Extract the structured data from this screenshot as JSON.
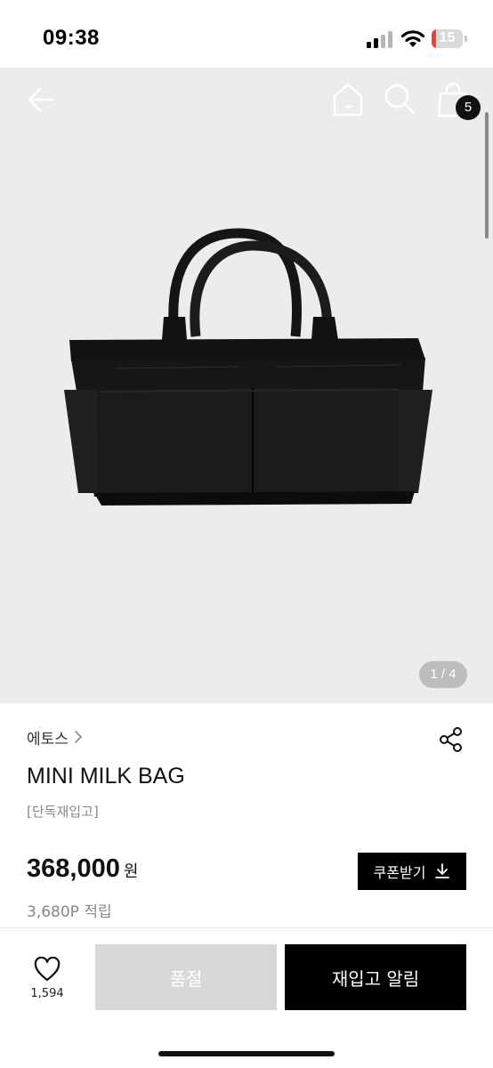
{
  "status_bar": {
    "time": "09:38",
    "battery_level": "15",
    "battery_fraction": 0.15,
    "icons": [
      "signal-icon",
      "wifi-icon",
      "battery-icon"
    ]
  },
  "nav": {
    "icons": [
      "back-arrow-icon",
      "home-icon",
      "search-icon",
      "shopping-bag-icon"
    ],
    "cart_count": "5"
  },
  "gallery": {
    "page_indicator": "1 / 4",
    "image": "black leather tote bag with two front pockets and rolled handles"
  },
  "product": {
    "brand": "에토스",
    "brand_chevron": "chevron-right-icon",
    "name": "MINI MILK BAG",
    "tag": "[단독재입고]",
    "price": "368,000",
    "price_unit": "원",
    "points": "3,680P 적립",
    "share_icon": "share-icon"
  },
  "coupon": {
    "label": "쿠폰받기",
    "icon": "download-icon"
  },
  "actions": {
    "wish_count": "1,594",
    "wish_icon": "heart-icon",
    "soldout_label": "품절",
    "restock_label": "재입고 알림"
  },
  "colors": {
    "accent": "#000000",
    "gallery_background": "#ececec",
    "soldout_background": "#d8d8d8",
    "battery_low": "#e8423b"
  }
}
